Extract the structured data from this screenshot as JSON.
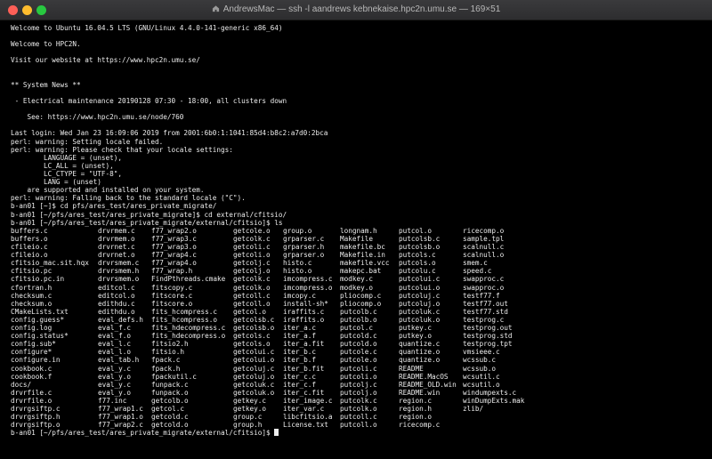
{
  "window": {
    "title": "AndrewsMac — ssh -l aandrews kebnekaise.hpc2n.umu.se — 169×51"
  },
  "output_lines": [
    "Welcome to Ubuntu 16.04.5 LTS (GNU/Linux 4.4.0-141-generic x86_64)",
    "",
    "Welcome to HPC2N.",
    "",
    "Visit our website at https://www.hpc2n.umu.se/",
    "",
    "",
    "** System News **",
    "",
    " - Electrical maintenance 20190128 07:30 - 18:00, all clusters down",
    "",
    "    See: https://www.hpc2n.umu.se/node/760",
    "",
    "Last login: Wed Jan 23 16:09:06 2019 from 2001:6b0:1:1041:85d4:b8c2:a7d0:2bca",
    "perl: warning: Setting locale failed.",
    "perl: warning: Please check that your locale settings:",
    "        LANGUAGE = (unset),",
    "        LC_ALL = (unset),",
    "        LC_CTYPE = \"UTF-8\",",
    "        LANG = (unset)",
    "    are supported and installed on your system.",
    "perl: warning: Falling back to the standard locale (\"C\").",
    "b-an01 [~]$ cd pfs/ares_test/ares_private_migrate/",
    "b-an01 [~/pfs/ares_test/ares_private_migrate]$ cd external/cfitsio/",
    "b-an01 [~/pfs/ares_test/ares_private_migrate/external/cfitsio]$ ls"
  ],
  "ls_rows": [
    [
      "buffers.c",
      "drvrmem.c",
      "f77_wrap2.o",
      "getcole.o",
      "group.o",
      "longnam.h",
      "putcol.o",
      "ricecomp.o"
    ],
    [
      "buffers.o",
      "drvrmem.o",
      "f77_wrap3.c",
      "getcolk.c",
      "grparser.c",
      "Makefile",
      "putcolsb.c",
      "sample.tpl"
    ],
    [
      "cfileio.c",
      "drvrnet.c",
      "f77_wrap3.o",
      "getcoli.c",
      "grparser.h",
      "makefile.bc",
      "putcolsb.o",
      "scalnull.c"
    ],
    [
      "cfileio.o",
      "drvrnet.o",
      "f77_wrap4.c",
      "getcoli.o",
      "grparser.o",
      "Makefile.in",
      "putcols.c",
      "scalnull.o"
    ],
    [
      "cfitsio_mac.sit.hqx",
      "drvrsmem.c",
      "f77_wrap4.o",
      "getcolj.c",
      "histo.c",
      "makefile.vcc",
      "putcols.o",
      "smem.c"
    ],
    [
      "cfitsio.pc",
      "drvrsmem.h",
      "f77_wrap.h",
      "getcolj.o",
      "histo.o",
      "makepc.bat",
      "putcolu.c",
      "speed.c"
    ],
    [
      "cfitsio.pc.in",
      "drvrsmem.o",
      "FindPthreads.cmake",
      "getcolk.c",
      "imcompress.c",
      "modkey.c",
      "putcolui.c",
      "swapproc.c"
    ],
    [
      "cfortran.h",
      "editcol.c",
      "fitscopy.c",
      "getcolk.o",
      "imcompress.o",
      "modkey.o",
      "putcolui.o",
      "swapproc.o"
    ],
    [
      "checksum.c",
      "editcol.o",
      "fitscore.c",
      "getcoll.c",
      "imcopy.c",
      "pliocomp.c",
      "putcoluj.c",
      "testf77.f"
    ],
    [
      "checksum.o",
      "edithdu.c",
      "fitscore.o",
      "getcoll.o",
      "install-sh*",
      "pliocomp.o",
      "putcoluj.o",
      "testf77.out"
    ],
    [
      "CMakeLists.txt",
      "edithdu.o",
      "fits_hcompress.c",
      "getcol.o",
      "iraffits.c",
      "putcolb.c",
      "putcoluk.c",
      "testf77.std"
    ],
    [
      "config.guess*",
      "eval_defs.h",
      "fits_hcompress.o",
      "getcolsb.c",
      "iraffits.o",
      "putcolb.o",
      "putcoluk.o",
      "testprog.c"
    ],
    [
      "config.log",
      "eval_f.c",
      "fits_hdecompress.c",
      "getcolsb.o",
      "iter_a.c",
      "putcol.c",
      "putkey.c",
      "testprog.out"
    ],
    [
      "config.status*",
      "eval_f.o",
      "fits_hdecompress.o",
      "getcols.c",
      "iter_a.f",
      "putcold.c",
      "putkey.o",
      "testprog.std"
    ],
    [
      "config.sub*",
      "eval_l.c",
      "fitsio2.h",
      "getcols.o",
      "iter_a.fit",
      "putcold.o",
      "quantize.c",
      "testprog.tpt"
    ],
    [
      "configure*",
      "eval_l.o",
      "fitsio.h",
      "getcolui.c",
      "iter_b.c",
      "putcole.c",
      "quantize.o",
      "vmsieee.c"
    ],
    [
      "configure.in",
      "eval_tab.h",
      "fpack.c",
      "getcolui.o",
      "iter_b.f",
      "putcole.o",
      "quantize.o",
      "wcssub.c"
    ],
    [
      "cookbook.c",
      "eval_y.c",
      "fpack.h",
      "getcoluj.c",
      "iter_b.fit",
      "putcoli.c",
      "README",
      "wcssub.o"
    ],
    [
      "cookbook.f",
      "eval_y.o",
      "fpackutil.c",
      "getcoluj.o",
      "iter_c.c",
      "putcoli.o",
      "README.MacOS",
      "wcsutil.c"
    ],
    [
      "docs/",
      "eval_y.c",
      "funpack.c",
      "getcoluk.c",
      "iter_c.f",
      "putcolj.c",
      "README_OLD.win",
      "wcsutil.o"
    ],
    [
      "drvrfile.c",
      "eval_y.o",
      "funpack.o",
      "getcoluk.o",
      "iter_c.fit",
      "putcolj.o",
      "README.win",
      "windumpexts.c"
    ],
    [
      "drvrfile.o",
      "f77.inc",
      "getcolb.o",
      "getkey.c",
      "iter_image.c",
      "putcolk.c",
      "region.c",
      "winDumpExts.mak"
    ],
    [
      "drvrgsiftp.c",
      "f77_wrap1.c",
      "getcol.c",
      "getkey.o",
      "iter_var.c",
      "putcolk.o",
      "region.h",
      "zlib/"
    ],
    [
      "drvrgsiftp.h",
      "f77_wrap1.o",
      "getcold.c",
      "group.c",
      "libcfitsio.a",
      "putcoll.c",
      "region.o",
      ""
    ],
    [
      "drvrgsiftp.o",
      "f77_wrap2.c",
      "getcold.o",
      "group.h",
      "License.txt",
      "putcoll.o",
      "ricecomp.c",
      ""
    ]
  ],
  "final_prompt": "b-an01 [~/pfs/ares_test/ares_private_migrate/external/cfitsio]$ ",
  "colors": {
    "background": "#000000",
    "foreground": "#ececec",
    "titlebar": "#2d2d2f",
    "close": "#fe5f57",
    "minimize": "#febc2e",
    "maximize": "#28c840"
  }
}
